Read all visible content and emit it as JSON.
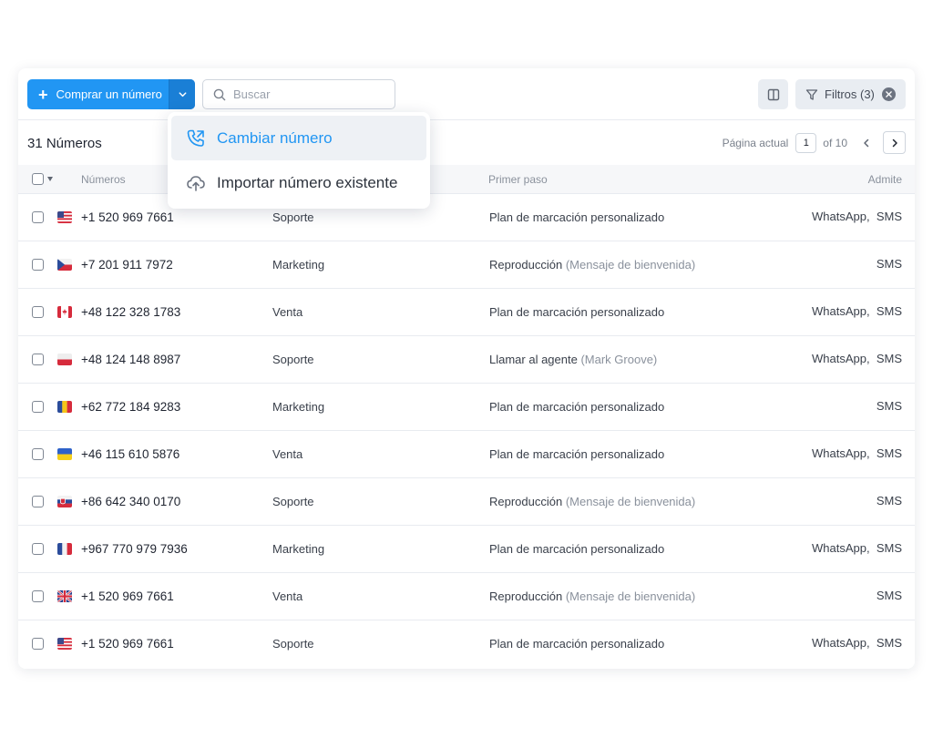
{
  "toolbar": {
    "buy_label": "Comprar un número",
    "search_placeholder": "Buscar",
    "filters_label": "Filtros (3)"
  },
  "menu": {
    "items": [
      {
        "label": "Cambiar número",
        "icon": "phone-forward-icon"
      },
      {
        "label": "Importar número existente",
        "icon": "cloud-upload-icon"
      }
    ]
  },
  "summary": {
    "count_label": "31 Números"
  },
  "pager": {
    "label": "Página actual",
    "current": "1",
    "total_label": "of 10"
  },
  "table": {
    "headers": {
      "numbers": "Números",
      "first_step": "Primer paso",
      "supports": "Admite"
    },
    "rows": [
      {
        "flag": "us",
        "number": "+1 520 969 7661",
        "dept": "Soporte",
        "step": "Plan de marcación personalizado",
        "step_sub": "",
        "supports": "WhatsApp,  SMS"
      },
      {
        "flag": "cz",
        "number": "+7 201 911 7972",
        "dept": "Marketing",
        "step": "Reproducción",
        "step_sub": "(Mensaje de bienvenida)",
        "supports": "SMS"
      },
      {
        "flag": "ca",
        "number": "+48 122 328 1783",
        "dept": "Venta",
        "step": "Plan de marcación personalizado",
        "step_sub": "",
        "supports": "WhatsApp,  SMS"
      },
      {
        "flag": "pl",
        "number": "+48 124 148 8987",
        "dept": "Soporte",
        "step": "Llamar al agente",
        "step_sub": "(Mark Groove)",
        "supports": "WhatsApp,  SMS"
      },
      {
        "flag": "ro",
        "number": "+62 772 184 9283",
        "dept": "Marketing",
        "step": "Plan de marcación personalizado",
        "step_sub": "",
        "supports": "SMS"
      },
      {
        "flag": "ua",
        "number": "+46 115 610 5876",
        "dept": "Venta",
        "step": "Plan de marcación personalizado",
        "step_sub": "",
        "supports": "WhatsApp,  SMS"
      },
      {
        "flag": "sk",
        "number": "+86 642 340 0170",
        "dept": "Soporte",
        "step": "Reproducción",
        "step_sub": "(Mensaje de bienvenida)",
        "supports": "SMS"
      },
      {
        "flag": "fr",
        "number": "+967 770 979 7936",
        "dept": "Marketing",
        "step": "Plan de marcación personalizado",
        "step_sub": "",
        "supports": "WhatsApp,  SMS"
      },
      {
        "flag": "gb",
        "number": "+1 520 969 7661",
        "dept": "Venta",
        "step": "Reproducción",
        "step_sub": "(Mensaje de bienvenida)",
        "supports": "SMS"
      },
      {
        "flag": "us",
        "number": "+1 520 969 7661",
        "dept": "Soporte",
        "step": "Plan de marcación personalizado",
        "step_sub": "",
        "supports": "WhatsApp,  SMS"
      }
    ]
  },
  "colors": {
    "accent": "#2196f3",
    "accent_dark": "#1a7fd6"
  }
}
